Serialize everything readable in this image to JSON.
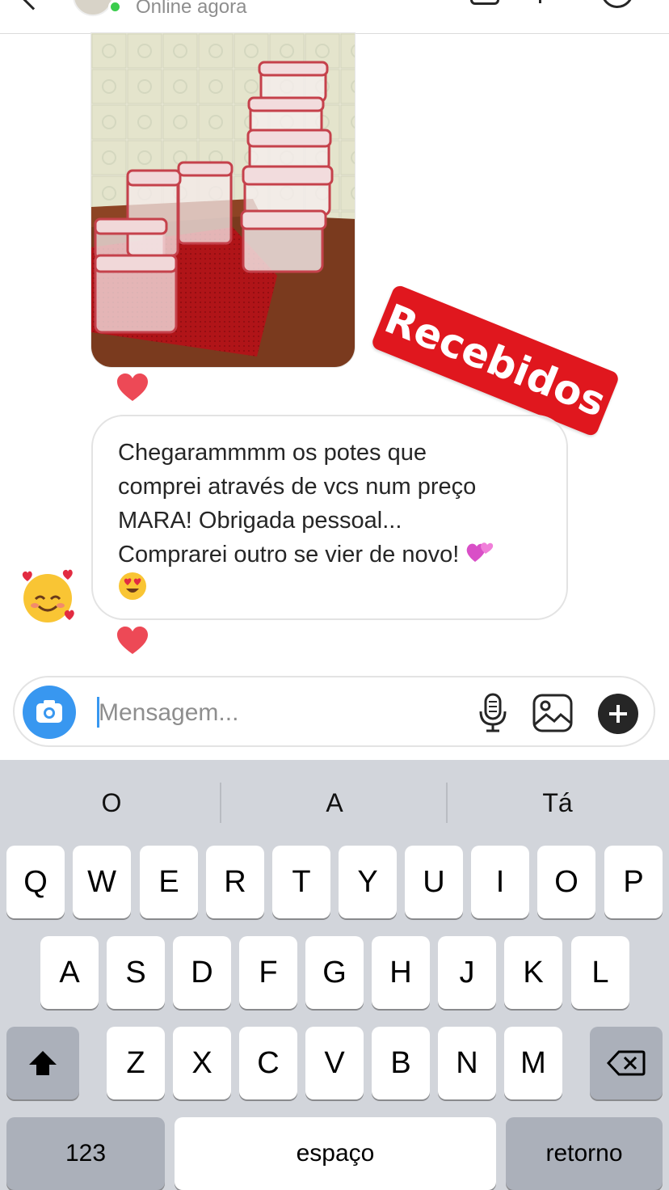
{
  "header": {
    "status": "Online agora"
  },
  "messages": {
    "sticker_text": "Recebidos",
    "text_line1": "Chegaramm​mm os potes que",
    "text_line2": "comprei através de vcs num preço",
    "text_line3": "MARA! Obrigada pessoal...",
    "text_line4": "Comprarei outro se vier de novo!"
  },
  "composer": {
    "placeholder": "Mensagem..."
  },
  "keyboard": {
    "suggestions": [
      "O",
      "A",
      "Tá"
    ],
    "row1": [
      "Q",
      "W",
      "E",
      "R",
      "T",
      "Y",
      "U",
      "I",
      "O",
      "P"
    ],
    "row2": [
      "A",
      "S",
      "D",
      "F",
      "G",
      "H",
      "J",
      "K",
      "L"
    ],
    "row3": [
      "Z",
      "X",
      "C",
      "V",
      "B",
      "N",
      "M"
    ],
    "numbers_key": "123",
    "space_key": "espaço",
    "return_key": "retorno"
  },
  "colors": {
    "accent_blue": "#3897f0",
    "heart_red": "#ed4956",
    "sticker_red": "#e0171e"
  },
  "icons": [
    "back-chevron-icon",
    "video-call-icon",
    "phone-icon",
    "info-icon",
    "heart-icon",
    "camera-icon",
    "microphone-icon",
    "gallery-icon",
    "plus-icon",
    "shift-icon",
    "delete-icon",
    "two-hearts-emoji",
    "heart-eyes-emoji",
    "smiling-face-with-hearts-emoji"
  ]
}
